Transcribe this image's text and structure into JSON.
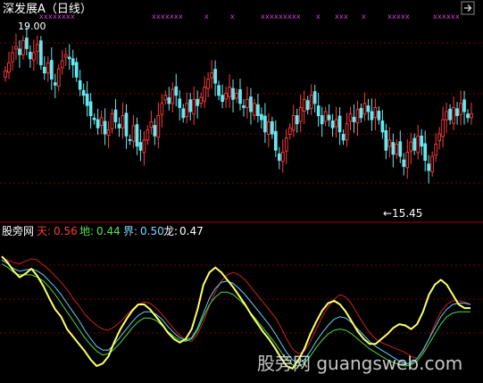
{
  "title": "深发展A（日线）",
  "legend": {
    "name": "股旁网",
    "items": [
      {
        "label": "天:",
        "value": "0.56",
        "color": "#ff3b3b"
      },
      {
        "label": "地:",
        "value": "0.44",
        "color": "#59e05a"
      },
      {
        "label": "界:",
        "value": "0.50",
        "color": "#7fd8ff"
      },
      {
        "label": "龙:",
        "value": "0.47",
        "color": "#ffffff"
      }
    ]
  },
  "high_label": "19.00",
  "low_label": "←15.45",
  "watermark": "股旁网 guangsweb.com",
  "colors": {
    "bg": "#000000",
    "up": "#ff3b3b",
    "down": "#66e8f0",
    "grid": "#7a0000",
    "markers": "#cc44cc",
    "tian": "#cc2222",
    "di": "#44dd44",
    "jie": "#66ccff",
    "long": "#ffff66"
  },
  "chart_data": [
    {
      "type": "candlestick",
      "title": "深发展A（日线）",
      "ylim": [
        14.8,
        19.5
      ],
      "annotations": [
        {
          "text": "19.00"
        },
        {
          "text": "←15.45"
        }
      ],
      "closes": [
        18.15,
        18.35,
        18.6,
        18.75,
        18.55,
        18.9,
        18.7,
        18.45,
        18.6,
        18.8,
        18.3,
        18.1,
        18.35,
        17.95,
        17.8,
        18.2,
        18.4,
        18.55,
        18.45,
        18.3,
        18.0,
        17.7,
        17.55,
        17.3,
        17.05,
        16.95,
        16.75,
        17.0,
        16.6,
        16.7,
        17.1,
        16.9,
        16.75,
        17.05,
        16.55,
        16.45,
        16.8,
        16.3,
        16.2,
        16.45,
        16.7,
        16.9,
        16.55,
        17.05,
        17.35,
        17.55,
        17.35,
        17.7,
        17.55,
        17.25,
        17.0,
        17.35,
        17.15,
        17.45,
        17.3,
        17.5,
        17.75,
        17.95,
        18.1,
        17.85,
        17.55,
        17.4,
        17.6,
        17.75,
        17.45,
        17.6,
        17.35,
        17.25,
        17.45,
        17.15,
        17.35,
        17.05,
        16.95,
        16.65,
        16.9,
        16.6,
        16.2,
        15.95,
        16.15,
        16.5,
        16.75,
        17.05,
        16.85,
        17.25,
        17.45,
        17.2,
        17.55,
        17.35,
        17.05,
        16.85,
        17.15,
        16.95,
        16.75,
        16.95,
        16.65,
        16.45,
        16.85,
        17.1,
        16.9,
        17.2,
        17.0,
        17.35,
        17.15,
        16.95,
        17.25,
        16.95,
        16.65,
        16.2,
        16.45,
        16.1,
        16.35,
        16.05,
        15.8,
        16.15,
        16.4,
        16.2,
        16.55,
        16.3,
        15.95,
        15.7,
        16.05,
        16.35,
        16.6,
        16.95,
        17.15,
        16.95,
        17.25,
        17.05,
        17.35,
        17.15,
        17.0,
        17.1
      ],
      "y_values": {
        "天": [
          0.88,
          0.86,
          0.84,
          0.83,
          0.85,
          0.87,
          0.86,
          0.82,
          0.78,
          0.73,
          0.68,
          0.62,
          0.55,
          0.49,
          0.42,
          0.37,
          0.33,
          0.3,
          0.29,
          0.32,
          0.36,
          0.41,
          0.46,
          0.5,
          0.52,
          0.51,
          0.47,
          0.42,
          0.36,
          0.3,
          0.25,
          0.21,
          0.2,
          0.26,
          0.36,
          0.49,
          0.6,
          0.69,
          0.74,
          0.76,
          0.74,
          0.7,
          0.64,
          0.58,
          0.52,
          0.46,
          0.4,
          0.32,
          0.22,
          0.14,
          0.1,
          0.12,
          0.2,
          0.3,
          0.4,
          0.48,
          0.54,
          0.58,
          0.56,
          0.5,
          0.42,
          0.34,
          0.27,
          0.22,
          0.19,
          0.17,
          0.15,
          0.13,
          0.11,
          0.08,
          0.06,
          0.12,
          0.22,
          0.34,
          0.44,
          0.5,
          0.53,
          0.53,
          0.52,
          0.5
        ],
        "地": [
          0.83,
          0.8,
          0.76,
          0.74,
          0.74,
          0.74,
          0.72,
          0.69,
          0.64,
          0.58,
          0.51,
          0.44,
          0.37,
          0.3,
          0.23,
          0.17,
          0.12,
          0.09,
          0.1,
          0.14,
          0.19,
          0.25,
          0.31,
          0.36,
          0.39,
          0.39,
          0.37,
          0.33,
          0.28,
          0.24,
          0.21,
          0.2,
          0.22,
          0.29,
          0.4,
          0.5,
          0.56,
          0.6,
          0.6,
          0.58,
          0.54,
          0.49,
          0.43,
          0.37,
          0.31,
          0.25,
          0.19,
          0.12,
          0.05,
          0.01,
          0.0,
          0.02,
          0.08,
          0.15,
          0.21,
          0.26,
          0.29,
          0.3,
          0.29,
          0.26,
          0.22,
          0.18,
          0.14,
          0.11,
          0.08,
          0.05,
          0.03,
          0.01,
          0.0,
          0.01,
          0.04,
          0.1,
          0.18,
          0.26,
          0.34,
          0.4,
          0.43,
          0.44,
          0.44,
          0.44
        ],
        "界": [
          0.86,
          0.83,
          0.79,
          0.77,
          0.78,
          0.79,
          0.77,
          0.74,
          0.69,
          0.64,
          0.58,
          0.51,
          0.44,
          0.37,
          0.29,
          0.22,
          0.16,
          0.13,
          0.13,
          0.18,
          0.24,
          0.3,
          0.36,
          0.41,
          0.44,
          0.44,
          0.42,
          0.38,
          0.32,
          0.27,
          0.23,
          0.21,
          0.23,
          0.31,
          0.43,
          0.55,
          0.63,
          0.68,
          0.69,
          0.67,
          0.63,
          0.58,
          0.52,
          0.46,
          0.4,
          0.34,
          0.27,
          0.19,
          0.11,
          0.05,
          0.03,
          0.05,
          0.12,
          0.2,
          0.27,
          0.33,
          0.38,
          0.4,
          0.39,
          0.35,
          0.3,
          0.25,
          0.2,
          0.16,
          0.13,
          0.1,
          0.07,
          0.04,
          0.02,
          0.02,
          0.06,
          0.13,
          0.22,
          0.31,
          0.4,
          0.46,
          0.5,
          0.51,
          0.51,
          0.5
        ],
        "龙": [
          0.89,
          0.84,
          0.77,
          0.72,
          0.75,
          0.79,
          0.73,
          0.65,
          0.55,
          0.46,
          0.4,
          0.3,
          0.24,
          0.18,
          0.12,
          0.05,
          0.0,
          0.02,
          0.08,
          0.2,
          0.3,
          0.38,
          0.45,
          0.5,
          0.5,
          0.46,
          0.4,
          0.34,
          0.27,
          0.22,
          0.19,
          0.22,
          0.3,
          0.46,
          0.66,
          0.76,
          0.8,
          0.76,
          0.7,
          0.64,
          0.57,
          0.5,
          0.42,
          0.35,
          0.28,
          0.22,
          0.15,
          0.07,
          0.0,
          -0.02,
          0.05,
          0.14,
          0.26,
          0.36,
          0.45,
          0.51,
          0.53,
          0.5,
          0.44,
          0.36,
          0.28,
          0.22,
          0.18,
          0.18,
          0.22,
          0.26,
          0.31,
          0.34,
          0.33,
          0.3,
          0.34,
          0.44,
          0.58,
          0.66,
          0.7,
          0.66,
          0.58,
          0.5,
          0.47,
          0.47
        ]
      },
      "ylim_indicator": [
        0,
        1
      ]
    }
  ]
}
